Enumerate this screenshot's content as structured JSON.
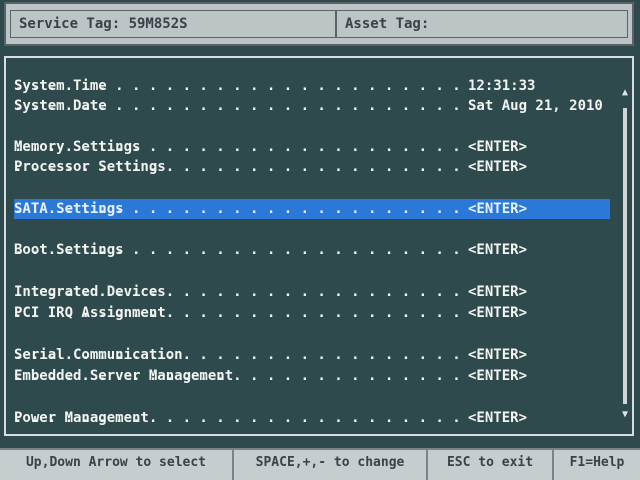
{
  "header": {
    "service_tag": "Service Tag: 59M852S",
    "asset_tag": "Asset Tag:"
  },
  "menu": {
    "items": [
      {
        "label": "System Time",
        "value": "12:31:33"
      },
      {
        "label": "System Date",
        "value": "Sat Aug 21, 2010"
      },
      {
        "label": "Memory Settings",
        "value": "<ENTER>"
      },
      {
        "label": "Processor Settings",
        "value": "<ENTER>"
      },
      {
        "label": "SATA Settings",
        "value": "<ENTER>"
      },
      {
        "label": "Boot Settings",
        "value": "<ENTER>"
      },
      {
        "label": "Integrated Devices",
        "value": "<ENTER>"
      },
      {
        "label": "PCI IRQ Assignment",
        "value": "<ENTER>"
      },
      {
        "label": "Serial Communication",
        "value": "<ENTER>"
      },
      {
        "label": "Embedded Server Management",
        "value": "<ENTER>"
      },
      {
        "label": "Power Management",
        "value": "<ENTER>"
      }
    ],
    "selected_index": 4
  },
  "scrollbar": {
    "up_icon": "up-arrow-icon",
    "down_icon": "down-arrow-icon"
  },
  "footer": {
    "nav_hint": "Up,Down Arrow to select",
    "change_hint": "SPACE,+,- to change",
    "exit_hint": "ESC to exit",
    "help_hint": "F1=Help"
  },
  "colors": {
    "background": "#2e4a4c",
    "selected": "#2a78d8",
    "text": "#f2f4f2",
    "header_bg": "#bcc4c6"
  }
}
